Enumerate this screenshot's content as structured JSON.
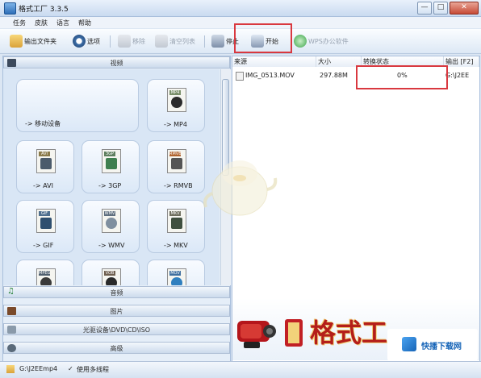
{
  "window": {
    "title": "格式工厂 3.3.5",
    "min_label": "—",
    "max_label": "□",
    "close_label": "✕"
  },
  "menu": [
    "任务",
    "皮肤",
    "语言",
    "帮助"
  ],
  "toolbar": {
    "output_folder": "输出文件夹",
    "options": "选项",
    "remove": "移除",
    "clear_list": "清空列表",
    "stop": "停止",
    "start": "开始",
    "wps": "WPS办公软件"
  },
  "categories": {
    "video": "视频",
    "audio": "音频",
    "picture": "图片",
    "rom": "光驱设备\\DVD\\CD\\ISO",
    "advanced": "高级"
  },
  "tiles": [
    {
      "label": "-> 移动设备",
      "icon": "mobile-device-icon"
    },
    {
      "label": "-> MP4",
      "tag": "MP4",
      "icon": "mp4-icon"
    },
    {
      "label": "-> AVI",
      "tag": "AVI",
      "icon": "avi-icon"
    },
    {
      "label": "-> 3GP",
      "tag": "3GP",
      "icon": "3gp-icon"
    },
    {
      "label": "-> RMVB",
      "tag": "RMVB",
      "icon": "rmvb-icon"
    },
    {
      "label": "-> GIF",
      "tag": "GIF",
      "icon": "gif-icon"
    },
    {
      "label": "-> WMV",
      "tag": "WMV",
      "icon": "wmv-icon"
    },
    {
      "label": "-> MKV",
      "tag": "MKV",
      "icon": "mkv-icon"
    },
    {
      "label": "",
      "tag": "MPEG",
      "icon": "mpeg-icon"
    },
    {
      "label": "",
      "tag": "VOB",
      "icon": "vob-icon"
    },
    {
      "label": "",
      "tag": "MOV",
      "icon": "mov-icon"
    }
  ],
  "table": {
    "headers": [
      "来源",
      "大小",
      "转换状态",
      "输出 [F2]"
    ],
    "rows": [
      {
        "source": "IMG_0513.MOV",
        "size": "297.88M",
        "status": "0%",
        "output": "G:\\J2EE"
      }
    ]
  },
  "status": {
    "path": "G:\\J2EEmp4",
    "multithread": "使用多线程",
    "check": "✓"
  },
  "branding": {
    "chars": "格式工",
    "site": "快播下载网"
  },
  "colors": {
    "highlight": "#d9383f",
    "brand_red": "#b41e1a",
    "accent_blue": "#2e6fb8"
  }
}
